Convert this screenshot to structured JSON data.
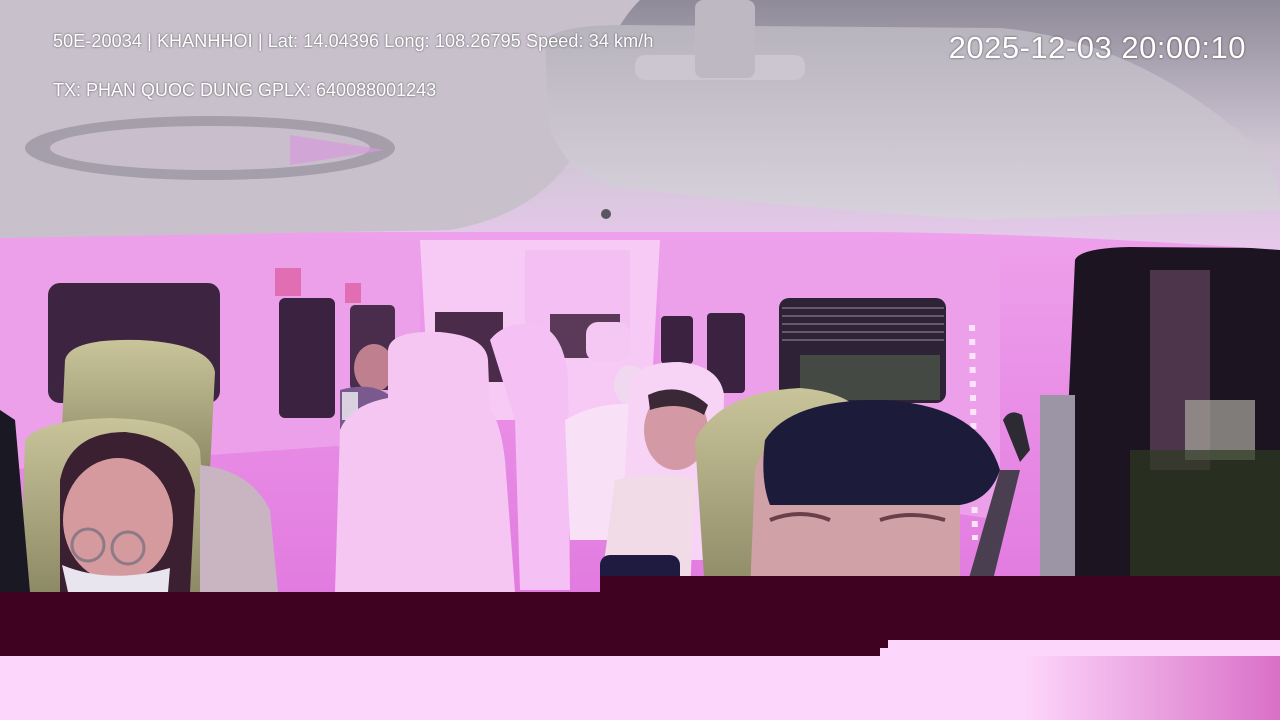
{
  "overlay": {
    "info_line": "50E-20034 | KHANHHOI | Lat: 14.04396 Long: 108.26795 Speed: 34 km/h",
    "driver_line": "TX: PHAN QUOC DUNG GPLX: 640088001243",
    "timestamp": "2025-12-03 20:00:10"
  },
  "colors": {
    "cabin_light": "#f3a8f0",
    "cabin_pink": "#e77ee6",
    "headliner_grey": "#bfb8c4",
    "corrupted_band_dark": "#3f0221",
    "corrupted_band_light": "#fdd6fb",
    "window_dark": "#221524"
  }
}
